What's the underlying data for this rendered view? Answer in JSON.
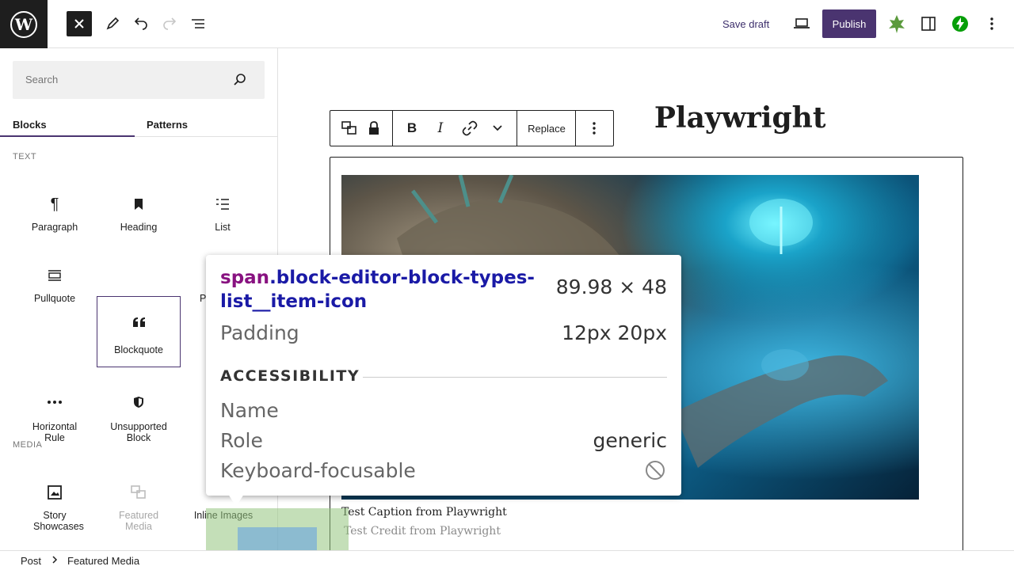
{
  "header": {
    "save_draft": "Save draft",
    "publish": "Publish"
  },
  "sidebar": {
    "search_placeholder": "Search",
    "tabs": [
      "Blocks",
      "Patterns"
    ],
    "sections": [
      "TEXT",
      "MEDIA"
    ],
    "text_blocks": [
      {
        "label": "Paragraph",
        "icon": "paragraph-icon"
      },
      {
        "label": "Heading",
        "icon": "bookmark-icon"
      },
      {
        "label": "List",
        "icon": "list-icon"
      },
      {
        "label": "Pullquote",
        "icon": "pullquote-icon"
      },
      {
        "label": "Blockquote",
        "icon": "quote-icon"
      },
      {
        "label": "P",
        "icon": ""
      },
      {
        "label": "Horizontal Rule",
        "icon": "ellipsis-icon"
      },
      {
        "label": "Unsupported Block",
        "icon": "shield-icon"
      }
    ],
    "media_blocks": [
      {
        "label": "Story Showcases",
        "icon": "gallery-icon"
      },
      {
        "label": "Featured Media",
        "icon": "featured-media-icon"
      },
      {
        "label": "Inline Images",
        "icon": "image-icon"
      }
    ]
  },
  "editor": {
    "post_title_visible": "Playwright",
    "toolbar": {
      "replace": "Replace"
    },
    "caption": "Test Caption from Playwright",
    "credit": "Test Credit from Playwright"
  },
  "breadcrumb": {
    "items": [
      "Post",
      "Featured Media"
    ]
  },
  "inspector": {
    "tag": "span",
    "class_line": ".block-editor-block-types-list__item-icon",
    "size": "89.98 × 48",
    "padding_label": "Padding",
    "padding_value": "12px 20px",
    "section": "ACCESSIBILITY",
    "name_label": "Name",
    "role_label": "Role",
    "role_value": "generic",
    "focus_label": "Keyboard-focusable"
  },
  "colors": {
    "accent": "#4a3470",
    "highlight_margin": "#93c47d",
    "highlight_content": "#6fa8dc"
  }
}
